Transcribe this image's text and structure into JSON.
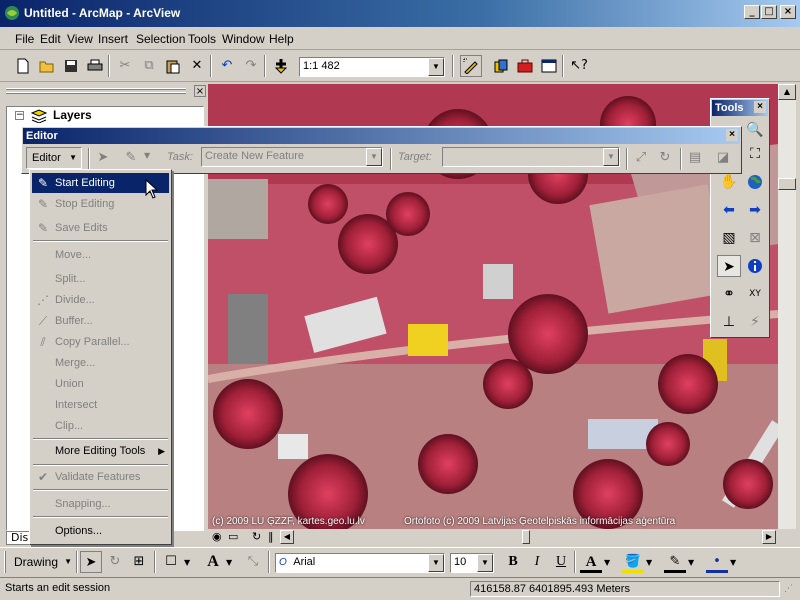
{
  "window": {
    "title": "Untitled - ArcMap - ArcView",
    "minimize": "_",
    "maximize": "□",
    "close": "×"
  },
  "menu": [
    "File",
    "Edit",
    "View",
    "Insert",
    "Selection",
    "Tools",
    "Window",
    "Help"
  ],
  "toolbar": {
    "scale_value": "1:1 482"
  },
  "toc": {
    "root_label": "Layers",
    "tab_label": "Dis"
  },
  "editor": {
    "title": "Editor",
    "menu_button": "Editor",
    "task_label": "Task:",
    "task_value": "Create New Feature",
    "target_label": "Target:",
    "target_value": ""
  },
  "editor_menu": {
    "items": [
      {
        "label": "Start Editing",
        "icon": "start-editing-icon",
        "state": "selected"
      },
      {
        "label": "Stop Editing",
        "icon": "stop-editing-icon",
        "state": "disabled"
      },
      {
        "label": "Save Edits",
        "icon": "save-edits-icon",
        "state": "disabled"
      },
      {
        "label": "Move...",
        "icon": "",
        "state": "disabled"
      },
      {
        "label": "Split...",
        "icon": "",
        "state": "disabled"
      },
      {
        "label": "Divide...",
        "icon": "divide-icon",
        "state": "disabled"
      },
      {
        "label": "Buffer...",
        "icon": "buffer-icon",
        "state": "disabled"
      },
      {
        "label": "Copy Parallel...",
        "icon": "copy-parallel-icon",
        "state": "disabled"
      },
      {
        "label": "Merge...",
        "icon": "",
        "state": "disabled"
      },
      {
        "label": "Union",
        "icon": "",
        "state": "disabled"
      },
      {
        "label": "Intersect",
        "icon": "",
        "state": "disabled"
      },
      {
        "label": "Clip...",
        "icon": "",
        "state": "disabled"
      },
      {
        "label": "More Editing Tools",
        "icon": "",
        "state": "normal"
      },
      {
        "label": "Validate Features",
        "icon": "validate-icon",
        "state": "disabled"
      },
      {
        "label": "Snapping...",
        "icon": "",
        "state": "disabled"
      },
      {
        "label": "Options...",
        "icon": "",
        "state": "normal"
      }
    ]
  },
  "tools": {
    "title": "Tools"
  },
  "map": {
    "credit_left": "(c) 2009 LU ĢZZF, kartes.geo.lu.lv",
    "credit_right": "Ortofoto (c) 2009 Latvijas Ģeotelpiskās informācijas aģentūra"
  },
  "drawing": {
    "menu_label": "Drawing",
    "font_name": "Arial",
    "font_size": "10",
    "bold": "B",
    "italic": "I",
    "underline": "U"
  },
  "status": {
    "message": "Starts an edit session",
    "coords": "416158.87  6401895.493 Meters"
  },
  "colors": {
    "title_bar": "#0a246a",
    "selection": "#0a246a",
    "map_tint": "#c04060"
  }
}
